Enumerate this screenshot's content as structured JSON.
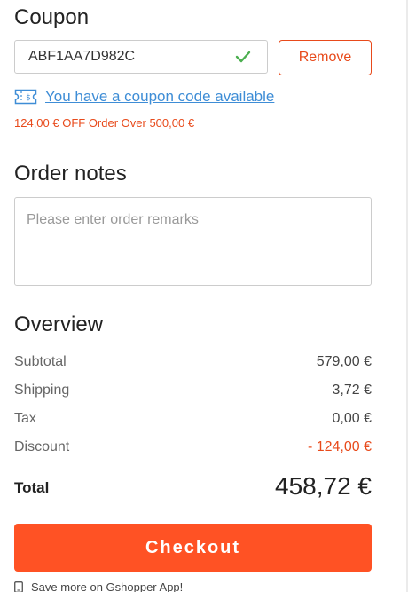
{
  "coupon": {
    "title": "Coupon",
    "code": "ABF1AA7D982C",
    "remove_label": "Remove",
    "available_text": "You have a coupon code available",
    "description": "124,00 € OFF Order Over 500,00 €"
  },
  "notes": {
    "title": "Order notes",
    "placeholder": "Please enter order remarks"
  },
  "overview": {
    "title": "Overview",
    "rows": [
      {
        "label": "Subtotal",
        "value": "579,00 €"
      },
      {
        "label": "Shipping",
        "value": "3,72 €"
      },
      {
        "label": "Tax",
        "value": "0,00 €"
      },
      {
        "label": "Discount",
        "value": "- 124,00 €"
      }
    ],
    "total_label": "Total",
    "total_value": "458,72 €"
  },
  "checkout": {
    "label": "Checkout",
    "app_note": "Save more on Gshopper App!"
  },
  "colors": {
    "accent": "#ff5224",
    "discount": "#e84a1b",
    "link": "#3e8dd6",
    "success": "#4caf50"
  },
  "icons": [
    "check-icon",
    "ticket-icon",
    "phone-icon"
  ]
}
